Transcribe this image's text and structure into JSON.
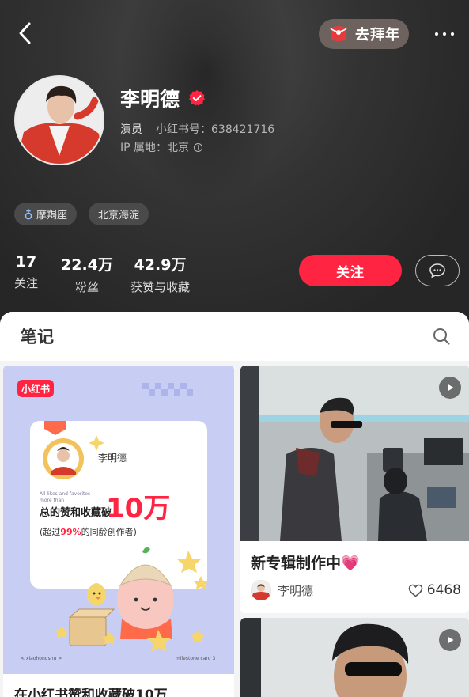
{
  "header": {
    "back_icon": "chevron-left-icon",
    "newyear_label": "去拜年",
    "more_icon": "more-dots-icon"
  },
  "profile": {
    "name": "李明德",
    "verified_icon": "verified-check-icon",
    "role": "演员",
    "redbook_id": "小红书号：638421716",
    "ip_location": "IP 属地：北京",
    "tags": [
      {
        "label": "摩羯座",
        "icon": "male-gender-icon"
      },
      {
        "label": "北京海淀"
      }
    ]
  },
  "stats": [
    {
      "value": "17",
      "label": "关注"
    },
    {
      "value": "22.4万",
      "label": "粉丝"
    },
    {
      "value": "42.9万",
      "label": "获赞与收藏"
    }
  ],
  "actions": {
    "follow_label": "关注",
    "message_icon": "chat-bubble-icon"
  },
  "notes": {
    "tab_label": "笔记",
    "search_icon": "search-icon",
    "cards": [
      {
        "poster": {
          "brand": "小红书",
          "user": "李明德",
          "small_text_1": "All likes and favorites",
          "small_text_2": "more than",
          "headline_prefix": "总的赞和收藏破",
          "headline_number": "10万",
          "sub_prefix": "(超过",
          "sub_percent": "99%",
          "sub_suffix": "的同龄创作者)",
          "footer_left": "< xiaohongshu >",
          "footer_right": "milestone card 3"
        },
        "caption": "在小红书赞和收藏破10万"
      },
      {
        "title": "新专辑制作中💗",
        "author": "李明德",
        "likes": "6468",
        "video": true
      },
      {
        "video": true
      }
    ]
  },
  "colors": {
    "accent": "#ff2442",
    "header_bg": "#2b2b2b",
    "poster_bg": "#c8cdf4"
  }
}
